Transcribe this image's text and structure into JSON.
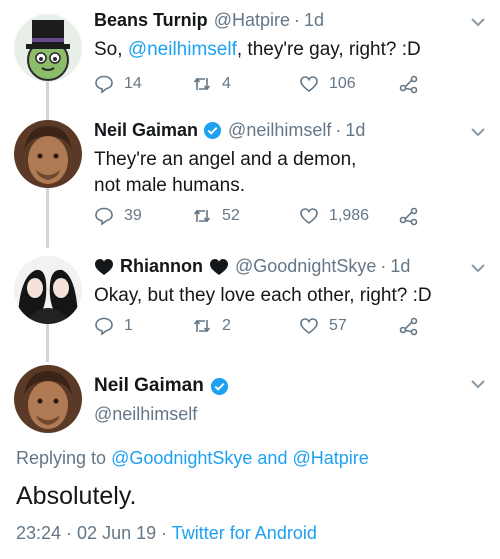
{
  "tweets": [
    {
      "name": "Beans Turnip",
      "handle": "@Hatpire",
      "time": "1d",
      "text_prefix": "So, ",
      "text_mention": "@neilhimself",
      "text_suffix": ", they're gay, right? :D",
      "replies": "14",
      "retweets": "4",
      "likes": "106"
    },
    {
      "name": "Neil Gaiman",
      "handle": "@neilhimself",
      "time": "1d",
      "text": "They're an angel and a demon, not male humans.",
      "replies": "39",
      "retweets": "52",
      "likes": "1,986"
    },
    {
      "name": "Rhiannon",
      "handle": "@GoodnightSkye",
      "time": "1d",
      "text": "Okay, but they love each other, right? :D",
      "replies": "1",
      "retweets": "2",
      "likes": "57"
    }
  ],
  "focus": {
    "name": "Neil Gaiman",
    "handle": "@neilhimself",
    "replying_prefix": "Replying to ",
    "replying_to_1": "@GoodnightSkye",
    "replying_and": " and ",
    "replying_to_2": "@Hatpire",
    "text": "Absolutely.",
    "timestamp": "23:24 · 02 Jun 19 · ",
    "source": "Twitter for Android"
  },
  "separator": "·",
  "colors": {
    "accent": "#1da1f2",
    "secondary_text": "#657786",
    "thread_line": "#ccd6dd"
  }
}
